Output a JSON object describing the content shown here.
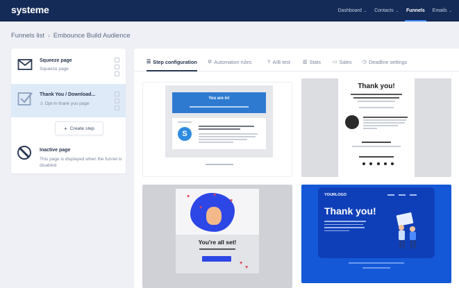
{
  "app": {
    "logo": "systeme"
  },
  "nav": {
    "items": [
      {
        "label": "Dashboard",
        "caret": "⌄",
        "active": false
      },
      {
        "label": "Contacts",
        "caret": "⌄",
        "active": false
      },
      {
        "label": "Funnels",
        "caret": "",
        "active": true
      },
      {
        "label": "Emails",
        "caret": "⌄",
        "active": false
      }
    ],
    "accent": "#3d8bf2",
    "background": "#142a57"
  },
  "breadcrumb": {
    "root": "Funnels list",
    "separator": "›",
    "current": "Embounce Build Audience"
  },
  "sidebar": {
    "steps": [
      {
        "title": "Squeeze page",
        "subtitle": "Squeeze page",
        "icon": "envelope-icon",
        "selected": false
      },
      {
        "title": "Thank You / Download...",
        "subtitle": "Opt-in thank you page",
        "icon": "checkbox-icon",
        "warning_icon": "warning-icon",
        "selected": true
      }
    ],
    "create_step": {
      "plus": "+",
      "label": "Create step"
    },
    "inactive": {
      "title": "Inactive page",
      "description": "This page is displayed when the funnel is disabled",
      "icon": "disabled-icon"
    },
    "selected_bg": "#dfeaf8"
  },
  "tabs": [
    {
      "label": "Step configuration",
      "icon": "list-icon",
      "glyph": "☰",
      "active": true
    },
    {
      "label": "Automation rules",
      "icon": "gears-icon",
      "glyph": "⚙",
      "active": false
    },
    {
      "label": "A/B test",
      "icon": "split-icon",
      "glyph": "Y",
      "active": false
    },
    {
      "label": "Stats",
      "icon": "bar-chart-icon",
      "glyph": "▥",
      "active": false
    },
    {
      "label": "Sales",
      "icon": "cash-icon",
      "glyph": "▭",
      "active": false
    },
    {
      "label": "Deadline settings",
      "icon": "clock-icon",
      "glyph": "◷",
      "active": false
    }
  ],
  "templates": {
    "squeeze": {
      "hero_title": "You are in!",
      "logo_letter": "S"
    },
    "thankyou": {
      "title": "Thank you!"
    },
    "allset": {
      "title": "You're all set!"
    },
    "yourlogo": {
      "logo": "YOURLOGO",
      "title": "Thank you!"
    }
  },
  "colors": {
    "primary_blue": "#2e7ad1",
    "template_blue": "#1458d8",
    "illustration_blue": "#2d46e6"
  }
}
